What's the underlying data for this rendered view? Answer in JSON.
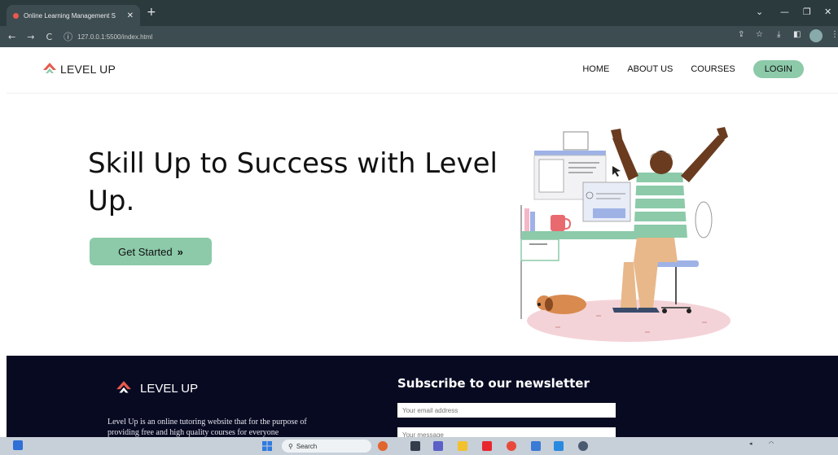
{
  "browser": {
    "tab_title": "Online Learning Management S",
    "tab_close": "✕",
    "new_tab": "+",
    "url": "127.0.0.1:5500/index.html",
    "back": "←",
    "forward": "→",
    "reload": "C"
  },
  "header": {
    "logo_text": "LEVEL  UP",
    "nav": {
      "home": "HOME",
      "about": "ABOUT US",
      "courses": "COURSES",
      "login": "LOGIN"
    }
  },
  "hero": {
    "title": "Skill Up to Success with Level Up.",
    "cta_label": "Get Started",
    "cta_arrow": "»"
  },
  "footer": {
    "logo_text": "LEVEL UP",
    "description": "Level Up is an online tutoring website that for the purpose of providing free and high quality courses for everyone",
    "newsletter_title": "Subscribe to our newsletter",
    "email_placeholder": "Your email address",
    "message_placeholder": "Your message"
  },
  "taskbar": {
    "search_label": "Search"
  },
  "colors": {
    "accent_green": "#8ccaa9",
    "footer_bg": "#080a22",
    "logo_red": "#e85a4f"
  }
}
